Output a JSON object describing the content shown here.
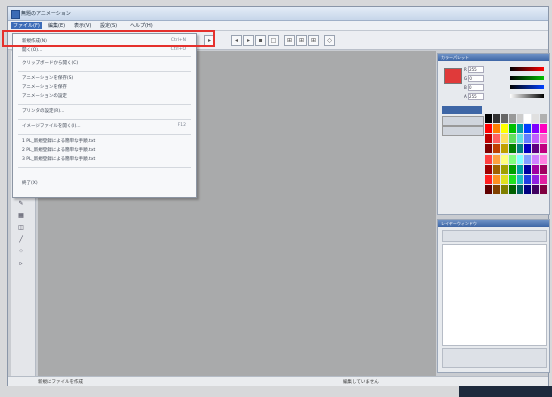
{
  "window": {
    "title": "無題のアニメーション"
  },
  "menubar": {
    "items": [
      {
        "label": "ファイル(F)"
      },
      {
        "label": "編集(E)"
      },
      {
        "label": "表示(V)"
      },
      {
        "label": "設定(S)"
      },
      {
        "label": "ヘルプ(H)"
      }
    ]
  },
  "file_menu": {
    "items": [
      {
        "label": "新規作成(N)",
        "shortcut": "Ctrl+N"
      },
      {
        "label": "開く(O)...",
        "shortcut": "Ctrl+O"
      },
      {
        "label": "クリップボードから開く(C)",
        "shortcut": ""
      },
      {
        "label": "アニメーションを保存(S)",
        "shortcut": ""
      },
      {
        "label": "アニメーションを保存",
        "shortcut": ""
      },
      {
        "label": "アニメーションの設定",
        "shortcut": ""
      },
      {
        "label": "プリンタの設定(R)...",
        "shortcut": ""
      },
      {
        "label": "イメージファイルを開く(I)...",
        "shortcut": "F12"
      },
      {
        "label": "1 PL_新規登録による簡単な手順.txt",
        "shortcut": ""
      },
      {
        "label": "2 PL_新規登録による簡単な手順.txt",
        "shortcut": ""
      },
      {
        "label": "3 PL_新規登録による簡単な手順.txt",
        "shortcut": ""
      },
      {
        "label": "終了(X)",
        "shortcut": ""
      }
    ]
  },
  "color_panel": {
    "title": "カラーパレット",
    "fields": [
      {
        "label": "R",
        "value": "255"
      },
      {
        "label": "G",
        "value": "0"
      },
      {
        "label": "B",
        "value": "0"
      },
      {
        "label": "A",
        "value": "255"
      }
    ],
    "current_color": "#e03a3a"
  },
  "layer_panel": {
    "title": "レイヤーウィンドウ"
  },
  "statusbar": {
    "left_text": "新規にファイルを作成",
    "right_text": "編集していません"
  },
  "palette_colors": [
    "#000000",
    "#333333",
    "#666666",
    "#999999",
    "#cccccc",
    "#ffffff",
    "#e0e0e0",
    "#b0b0b0",
    "#ff0000",
    "#ff8000",
    "#ffff00",
    "#00c000",
    "#00a0a0",
    "#0040ff",
    "#8000ff",
    "#ff00c0",
    "#c00000",
    "#ff6060",
    "#ffe060",
    "#60e060",
    "#60e0e0",
    "#6080ff",
    "#c060ff",
    "#ff60d0",
    "#800000",
    "#c04000",
    "#c0a000",
    "#008000",
    "#008080",
    "#0000c0",
    "#600080",
    "#c00080",
    "#ff4040",
    "#ffa040",
    "#ffff80",
    "#80ff80",
    "#80ffff",
    "#80a0ff",
    "#d080ff",
    "#ff80e0",
    "#a00000",
    "#a06000",
    "#a0a000",
    "#00a000",
    "#00a0a0",
    "#0000a0",
    "#a000a0",
    "#a00060",
    "#ff2020",
    "#ff9020",
    "#e0e020",
    "#20e020",
    "#20c0c0",
    "#2040e0",
    "#9020e0",
    "#e020a0",
    "#600000",
    "#804000",
    "#808000",
    "#006000",
    "#006060",
    "#000080",
    "#400060",
    "#800040"
  ]
}
